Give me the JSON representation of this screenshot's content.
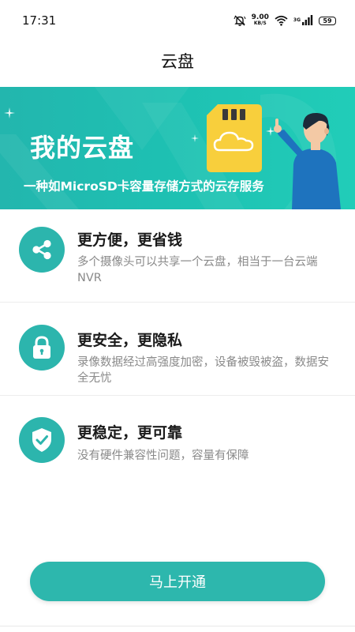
{
  "status_bar": {
    "time": "17:31",
    "speed_value": "9.00",
    "speed_unit": "KB/S",
    "network_label": "3G",
    "battery": "59",
    "icons": [
      "mute-bell-icon",
      "wifi-icon",
      "cell-signal-icon",
      "battery-icon"
    ]
  },
  "header": {
    "title": "云盘"
  },
  "banner": {
    "title": "我的云盘",
    "subtitle": "一种如MicroSD卡容量存储方式的云存服务",
    "colors": {
      "start": "#23b6ae",
      "end": "#21cdb8",
      "card": "#f8cf3c",
      "shirt": "#1e73be"
    },
    "icons": [
      "sd-card-icon",
      "cloud-icon",
      "person-illustration",
      "sparkle-icon"
    ]
  },
  "features": [
    {
      "icon": "share-icon",
      "title": "更方便，更省钱",
      "desc": "多个摄像头可以共享一个云盘，相当于一台云端NVR"
    },
    {
      "icon": "lock-icon",
      "title": "更安全，更隐私",
      "desc": "录像数据经过高强度加密，设备被毁被盗，数据安全无忧"
    },
    {
      "icon": "shield-check-icon",
      "title": "更稳定，更可靠",
      "desc": "没有硬件兼容性问题，容量有保障"
    }
  ],
  "accent_color": "#2db7ad",
  "action": {
    "label": "马上开通"
  }
}
